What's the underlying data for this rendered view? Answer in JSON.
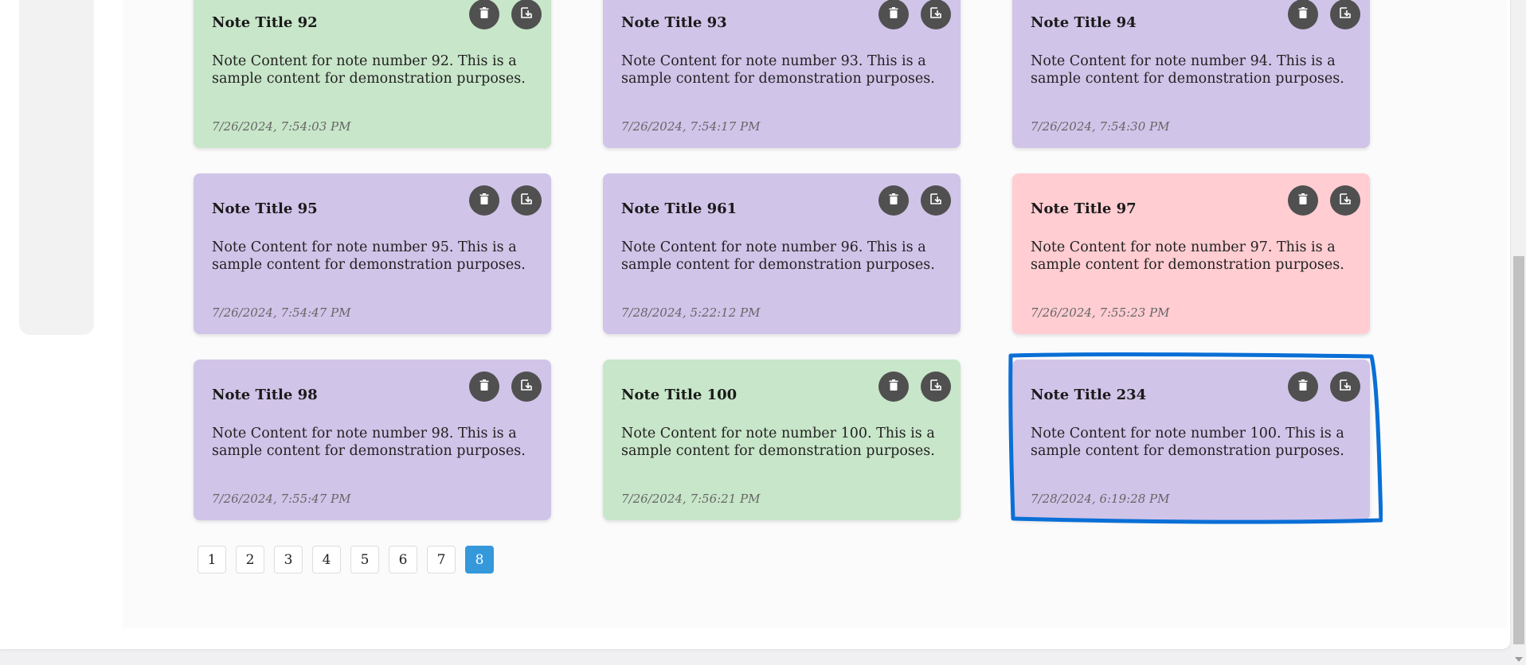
{
  "notes": [
    {
      "title": "Note Title 92",
      "content": "Note Content for note number 92. This is a sample content for demonstration purposes.",
      "date": "7/26/2024, 7:54:03 PM",
      "color": "#c8e6c9"
    },
    {
      "title": "Note Title 93",
      "content": "Note Content for note number 93. This is a sample content for demonstration purposes.",
      "date": "7/26/2024, 7:54:17 PM",
      "color": "#d1c4e9"
    },
    {
      "title": "Note Title 94",
      "content": "Note Content for note number 94. This is a sample content for demonstration purposes.",
      "date": "7/26/2024, 7:54:30 PM",
      "color": "#d1c4e9"
    },
    {
      "title": "Note Title 95",
      "content": "Note Content for note number 95. This is a sample content for demonstration purposes.",
      "date": "7/26/2024, 7:54:47 PM",
      "color": "#d1c4e9"
    },
    {
      "title": "Note Title 961",
      "content": "Note Content for note number 96. This is a sample content for demonstration purposes.",
      "date": "7/28/2024, 5:22:12 PM",
      "color": "#d1c4e9"
    },
    {
      "title": "Note Title 97",
      "content": "Note Content for note number 97. This is a sample content for demonstration purposes.",
      "date": "7/26/2024, 7:55:23 PM",
      "color": "#ffcdd2"
    },
    {
      "title": "Note Title 98",
      "content": "Note Content for note number 98. This is a sample content for demonstration purposes.",
      "date": "7/26/2024, 7:55:47 PM",
      "color": "#d1c4e9"
    },
    {
      "title": "Note Title 100",
      "content": "Note Content for note number 100. This is a sample content for demonstration purposes.",
      "date": "7/26/2024, 7:56:21 PM",
      "color": "#c8e6c9"
    },
    {
      "title": "Note Title 234",
      "content": "Note Content for note number 100. This is a sample content for demonstration purposes.",
      "date": "7/28/2024, 6:19:28 PM",
      "color": "#d1c4e9"
    }
  ],
  "icons": {
    "delete": "trash-icon",
    "download": "download-icon"
  },
  "pagination": {
    "pages": [
      "1",
      "2",
      "3",
      "4",
      "5",
      "6",
      "7",
      "8"
    ],
    "active": "8",
    "active_color": "#3498db"
  },
  "highlight_color": "#0a6fd6"
}
